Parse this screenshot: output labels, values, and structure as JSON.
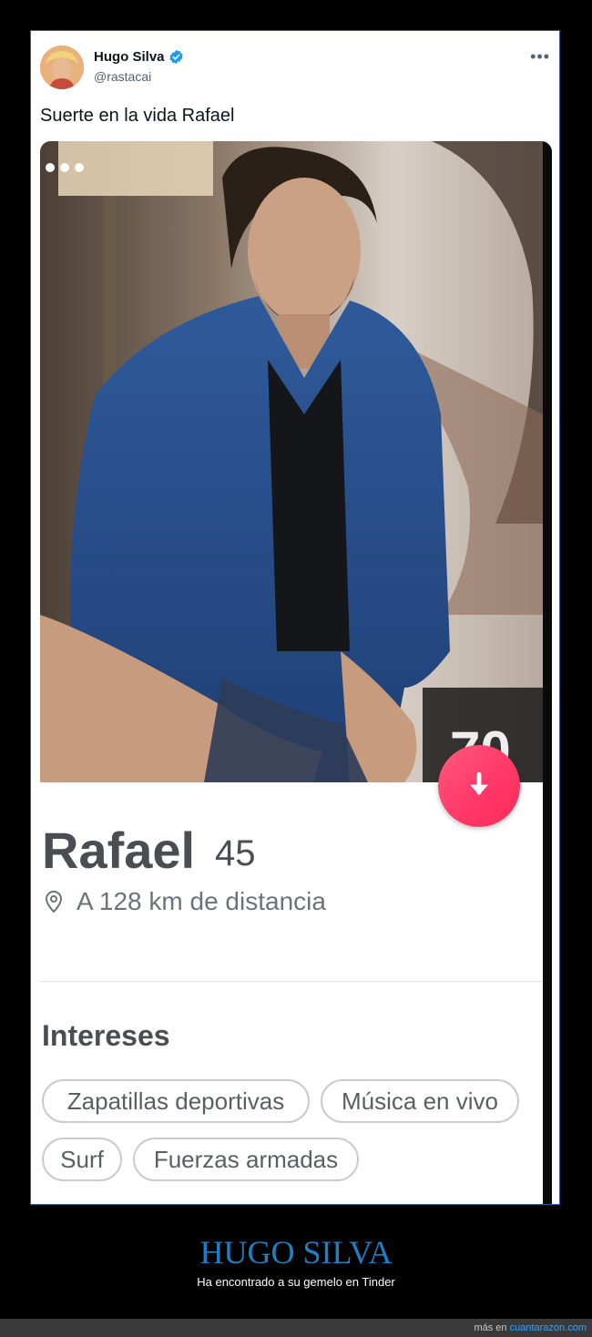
{
  "tweet": {
    "display_name": "Hugo Silva",
    "handle": "@rastacai",
    "text": "Suerte en la vida Rafael",
    "more_icon": "more-horizontal-icon"
  },
  "profile": {
    "name": "Rafael",
    "age": "45",
    "distance": "A 128 km de distancia",
    "interests_title": "Intereses",
    "interests": [
      "Zapatillas deportivas",
      "Música en vivo",
      "Surf",
      "Fuerzas armadas"
    ],
    "photo_count": 3,
    "accent_color": "#ff3b6b"
  },
  "caption": {
    "title": "HUGO SILVA",
    "subtitle": "Ha encontrado a su gemelo en Tinder"
  },
  "footer": {
    "prefix": "más en",
    "site": "cuantarazon.com"
  }
}
